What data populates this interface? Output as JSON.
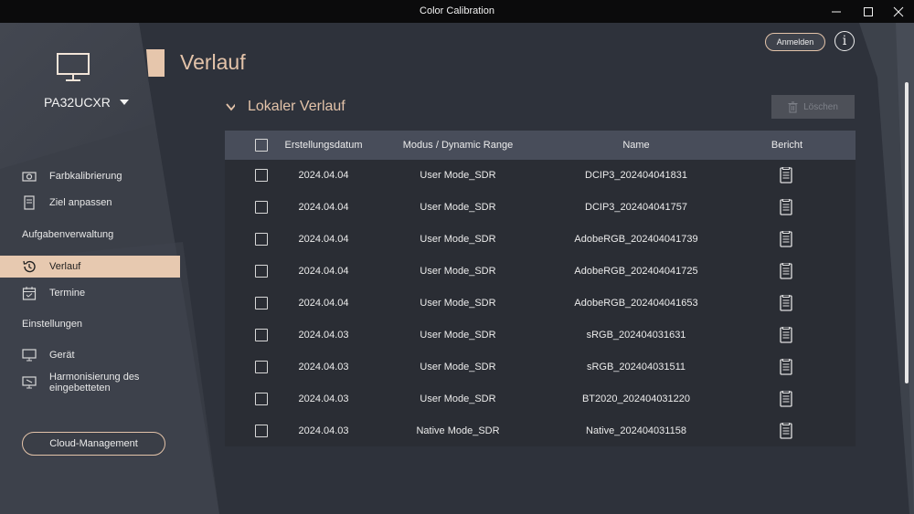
{
  "window": {
    "title": "Color Calibration",
    "controls": [
      "minimize",
      "maximize",
      "close"
    ]
  },
  "header": {
    "login_label": "Anmelden",
    "info_label": "i"
  },
  "sidebar": {
    "device_name": "PA32UCXR",
    "items": [
      {
        "label": "Farbkalibrierung",
        "icon": "camera-icon"
      },
      {
        "label": "Ziel anpassen",
        "icon": "document-icon"
      }
    ],
    "section_tasks": "Aufgabenverwaltung",
    "task_items": [
      {
        "label": "Verlauf",
        "icon": "history-icon",
        "active": true
      },
      {
        "label": "Termine",
        "icon": "calendar-icon"
      }
    ],
    "section_settings": "Einstellungen",
    "settings_items": [
      {
        "label": "Gerät",
        "icon": "monitor-icon"
      },
      {
        "label": "Harmonisierung des eingebetteten",
        "icon": "monitor-sync-icon"
      }
    ],
    "cloud_label": "Cloud-Management"
  },
  "main": {
    "page_title": "Verlauf",
    "section_label": "Lokaler Verlauf",
    "delete_label": "Löschen",
    "table": {
      "headers": {
        "date": "Erstellungsdatum",
        "mode": "Modus / Dynamic Range",
        "name": "Name",
        "report": "Bericht"
      },
      "rows": [
        {
          "date": "2024.04.04",
          "mode": "User Mode_SDR",
          "name": "DCIP3_202404041831"
        },
        {
          "date": "2024.04.04",
          "mode": "User Mode_SDR",
          "name": "DCIP3_202404041757"
        },
        {
          "date": "2024.04.04",
          "mode": "User Mode_SDR",
          "name": "AdobeRGB_202404041739"
        },
        {
          "date": "2024.04.04",
          "mode": "User Mode_SDR",
          "name": "AdobeRGB_202404041725"
        },
        {
          "date": "2024.04.04",
          "mode": "User Mode_SDR",
          "name": "AdobeRGB_202404041653"
        },
        {
          "date": "2024.04.03",
          "mode": "User Mode_SDR",
          "name": "sRGB_202404031631"
        },
        {
          "date": "2024.04.03",
          "mode": "User Mode_SDR",
          "name": "sRGB_202404031511"
        },
        {
          "date": "2024.04.03",
          "mode": "User Mode_SDR",
          "name": "BT2020_202404031220"
        },
        {
          "date": "2024.04.03",
          "mode": "Native Mode_SDR",
          "name": "Native_202404031158"
        }
      ]
    }
  },
  "colors": {
    "accent": "#e3c3a9",
    "background": "#2e323b",
    "table_header": "#484d5a"
  }
}
